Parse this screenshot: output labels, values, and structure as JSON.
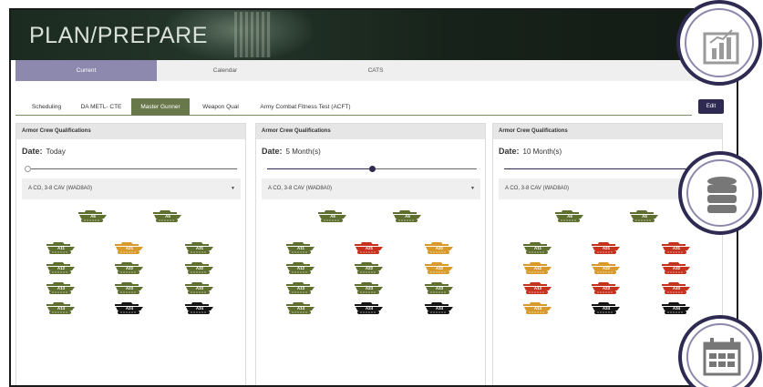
{
  "banner": {
    "title": "PLAN/PREPARE"
  },
  "topnav": {
    "tabs": [
      {
        "label": "Current"
      },
      {
        "label": "Calendar"
      },
      {
        "label": "CATS"
      }
    ]
  },
  "subtabs": [
    {
      "label": "Scheduling"
    },
    {
      "label": "DA METL- CTE"
    },
    {
      "label": "Master Gunner"
    },
    {
      "label": "Weapon Qual"
    },
    {
      "label": "Army Combat Fitness Test (ACFT)"
    }
  ],
  "edit_label": "Edit",
  "colors": {
    "green": "#5f6f2f",
    "orange": "#d89a2a",
    "red": "#c6321e",
    "black": "#141414",
    "accent": "#2e2a52",
    "active_tab": "#8d88ad"
  },
  "panels": [
    {
      "header": "Armor Crew Qualifications",
      "date_label": "Date:",
      "date_value": "Today",
      "slider_fraction": 0.0,
      "unit_select": "A CO, 3-8 CAV (WAD8A0)",
      "tanks": [
        {
          "label": "A6",
          "status": "green"
        },
        {
          "label": "A5",
          "status": "green"
        },
        {
          "label": "A11",
          "status": "green"
        },
        {
          "label": "A21",
          "status": "orange"
        },
        {
          "label": "A31",
          "status": "green"
        },
        {
          "label": "A12",
          "status": "green"
        },
        {
          "label": "A22",
          "status": "green"
        },
        {
          "label": "A32",
          "status": "green"
        },
        {
          "label": "A13",
          "status": "green"
        },
        {
          "label": "A23",
          "status": "green"
        },
        {
          "label": "A33",
          "status": "green"
        },
        {
          "label": "A14",
          "status": "green"
        },
        {
          "label": "A24",
          "status": "black"
        },
        {
          "label": "A34",
          "status": "black"
        }
      ]
    },
    {
      "header": "Armor Crew Qualifications",
      "date_label": "Date:",
      "date_value": "5 Month(s)",
      "slider_fraction": 0.5,
      "unit_select": "A CO, 3-8 CAV (WAD8A0)",
      "tanks": [
        {
          "label": "A6",
          "status": "green"
        },
        {
          "label": "A5",
          "status": "green"
        },
        {
          "label": "A11",
          "status": "green"
        },
        {
          "label": "A21",
          "status": "red"
        },
        {
          "label": "A31",
          "status": "orange"
        },
        {
          "label": "A12",
          "status": "green"
        },
        {
          "label": "A22",
          "status": "green"
        },
        {
          "label": "A32",
          "status": "orange"
        },
        {
          "label": "A13",
          "status": "green"
        },
        {
          "label": "A23",
          "status": "green"
        },
        {
          "label": "A33",
          "status": "green"
        },
        {
          "label": "A14",
          "status": "green"
        },
        {
          "label": "A24",
          "status": "black"
        },
        {
          "label": "A34",
          "status": "black"
        }
      ]
    },
    {
      "header": "Armor Crew Qualifications",
      "date_label": "Date:",
      "date_value": "10 Month(s)",
      "slider_fraction": 1.0,
      "unit_select": "A CO, 3-8 CAV (WAD8A0)",
      "tanks": [
        {
          "label": "A6",
          "status": "green"
        },
        {
          "label": "A5",
          "status": "green"
        },
        {
          "label": "A11",
          "status": "green"
        },
        {
          "label": "A21",
          "status": "red"
        },
        {
          "label": "A31",
          "status": "red"
        },
        {
          "label": "A12",
          "status": "orange"
        },
        {
          "label": "A22",
          "status": "orange"
        },
        {
          "label": "A32",
          "status": "red"
        },
        {
          "label": "A13",
          "status": "red"
        },
        {
          "label": "A23",
          "status": "red"
        },
        {
          "label": "A33",
          "status": "red"
        },
        {
          "label": "A14",
          "status": "orange"
        },
        {
          "label": "A24",
          "status": "black"
        },
        {
          "label": "A34",
          "status": "black"
        }
      ]
    }
  ],
  "side_icons": [
    "chart-icon",
    "database-icon",
    "calendar-icon"
  ]
}
